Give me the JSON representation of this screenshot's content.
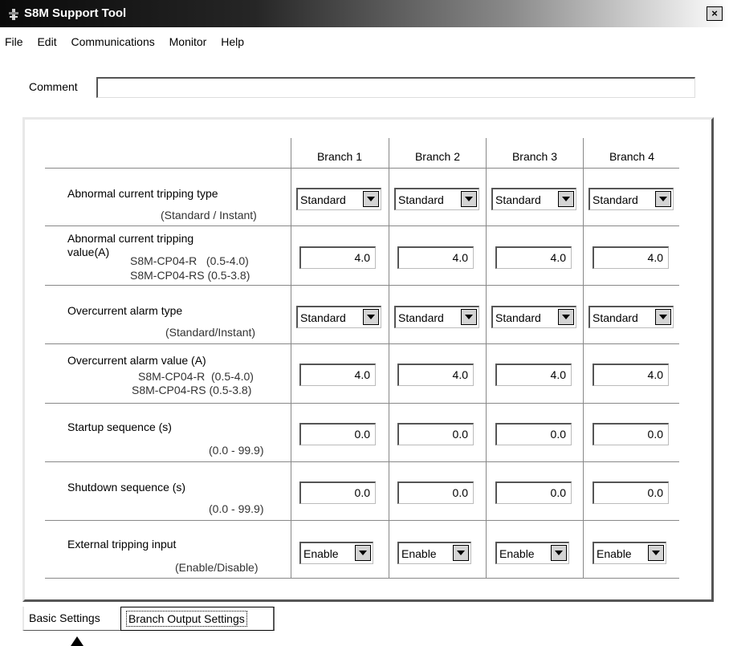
{
  "window": {
    "title": "S8M Support Tool",
    "close_label": "×"
  },
  "menu": [
    "File",
    "Edit",
    "Communications",
    "Monitor",
    "Help"
  ],
  "comment": {
    "label": "Comment",
    "value": ""
  },
  "branches": [
    "Branch 1",
    "Branch 2",
    "Branch 3",
    "Branch 4"
  ],
  "rows": {
    "abn_type": {
      "label": "Abnormal current tripping type",
      "range": "(Standard / Instant)",
      "values": [
        "Standard",
        "Standard",
        "Standard",
        "Standard"
      ]
    },
    "abn_value": {
      "label": "Abnormal current tripping",
      "label2": "value(A)",
      "range1": "S8M-CP04-R   (0.5-4.0)",
      "range2": "S8M-CP04-RS (0.5-3.8)",
      "values": [
        "4.0",
        "4.0",
        "4.0",
        "4.0"
      ]
    },
    "oc_type": {
      "label": "Overcurrent alarm type",
      "range": "(Standard/Instant)",
      "values": [
        "Standard",
        "Standard",
        "Standard",
        "Standard"
      ]
    },
    "oc_value": {
      "label": "Overcurrent alarm value (A)",
      "range1": "S8M-CP04-R  (0.5-4.0)",
      "range2": "S8M-CP04-RS (0.5-3.8)",
      "values": [
        "4.0",
        "4.0",
        "4.0",
        "4.0"
      ]
    },
    "startup": {
      "label": "Startup sequence (s)",
      "range": "(0.0 - 99.9)",
      "values": [
        "0.0",
        "0.0",
        "0.0",
        "0.0"
      ]
    },
    "shutdown": {
      "label": "Shutdown sequence (s)",
      "range": "(0.0 - 99.9)",
      "values": [
        "0.0",
        "0.0",
        "0.0",
        "0.0"
      ]
    },
    "ext_trip": {
      "label": "External tripping input",
      "range": "(Enable/Disable)",
      "values": [
        "Enable",
        "Enable",
        "Enable",
        "Enable"
      ]
    }
  },
  "tabs": {
    "basic": "Basic Settings",
    "branch": "Branch Output Settings"
  }
}
